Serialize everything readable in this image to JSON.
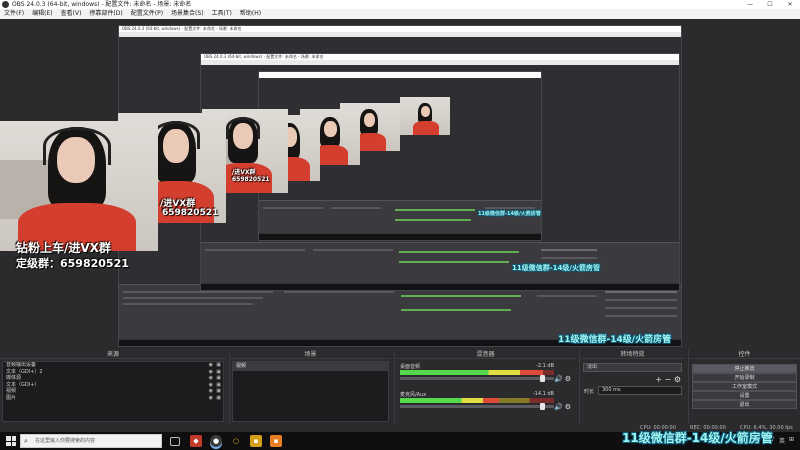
{
  "window": {
    "title": "OBS 24.0.3 (64-bit, windows) - 配置文件: 未命名 - 场景: 未命名",
    "controls": [
      "—",
      "☐",
      "✕"
    ]
  },
  "menu": [
    "文件(F)",
    "编辑(E)",
    "查看(V)",
    "停靠部件(D)",
    "配置文件(P)",
    "场景集合(S)",
    "工具(T)",
    "帮助(H)"
  ],
  "overlay": {
    "line1": "钻粉上车/进VX群",
    "line2": "定级群：659820521",
    "small1": "/进VX群",
    "small2": "659820521",
    "banner": "11级微信群-14级/火箭房管"
  },
  "docks": {
    "sources": {
      "title": "来源",
      "items": [
        "音频输出设备",
        "文本（GDI+）2",
        "媒体源",
        "文本（GDI+）",
        "视频",
        "图片"
      ]
    },
    "scenes": {
      "title": "场景",
      "items": [
        "视频"
      ]
    },
    "mixer": {
      "title": "混音器",
      "tracks": [
        {
          "name": "桌面音频",
          "db": "-2.1 dB",
          "level": 0.93,
          "volume": 0.93
        },
        {
          "name": "麦克风/Aux",
          "db": "-14.1 dB",
          "level": 0.64,
          "volume": 0.93
        }
      ]
    },
    "transitions": {
      "title": "转场特效",
      "selected": "淡出",
      "duration_label": "时长",
      "duration": "300 ms"
    },
    "controls": {
      "title": "控件",
      "buttons": [
        "停止推流",
        "开始录制",
        "工作室模式",
        "设置",
        "退出"
      ]
    }
  },
  "footer_icons": {
    "add": "+",
    "remove": "−",
    "gear": "⚙",
    "up": "⌃",
    "down": "⌄"
  },
  "status": {
    "cpu": "CPU: 00:00:00",
    "rec": "REC: 00:00:00",
    "fps": "CPU: 6.4%, 30.00 fps"
  },
  "taskbar": {
    "search_placeholder": "在这里输入你要搜索的内容",
    "tray": [
      "^",
      "♪",
      "英",
      "⊞"
    ]
  }
}
